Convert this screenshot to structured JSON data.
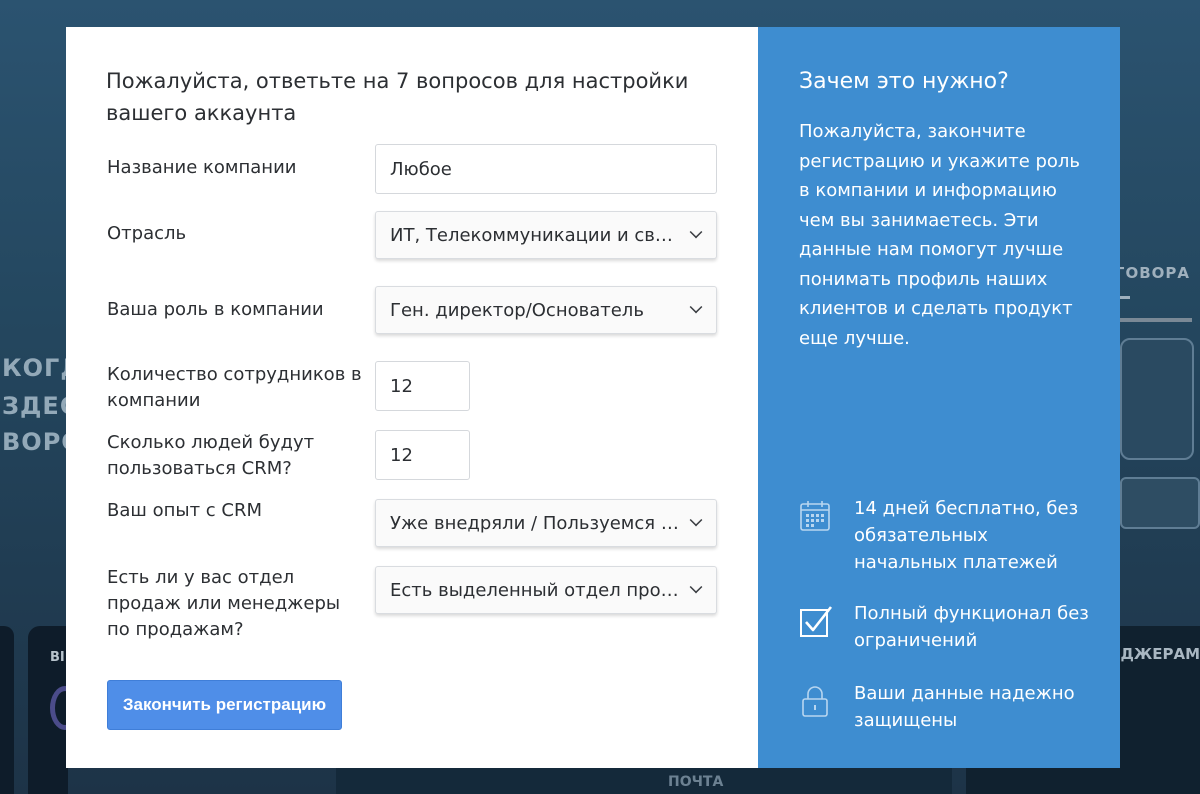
{
  "background": {
    "left_lines": [
      "КОГД",
      "ЗДЕС",
      "ВОРС"
    ],
    "right_heading": "ГОВОРА",
    "right_heading2": "ЕДЖЕРАМ",
    "left_small": "ВІ",
    "bottom_label": "ПОЧТА"
  },
  "form": {
    "title": "Пожалуйста, ответьте на 7 вопросов для настройки вашего аккаунта",
    "company_name": {
      "label": "Название компании",
      "value": "Любое"
    },
    "industry": {
      "label": "Отрасль",
      "value": "ИТ, Телекоммуникации и связь"
    },
    "role": {
      "label": "Ваша роль в компании",
      "value": "Ген. директор/Основатель"
    },
    "employees": {
      "label": "Количество сотрудников в компании",
      "value": "12"
    },
    "crm_users": {
      "label": "Сколько людей будут пользоваться CRM?",
      "value": "12"
    },
    "crm_experience": {
      "label": "Ваш опыт с CRM",
      "value": "Уже внедряли / Пользуемся CRM"
    },
    "sales_dept": {
      "label": "Есть ли у вас отдел продаж или менеджеры по продажам?",
      "value": "Есть выделенный отдел продаж"
    },
    "submit_label": "Закончить регистрацию"
  },
  "info": {
    "title": "Зачем это нужно?",
    "text": "Пожалуйста, закончите регистрацию и укажите роль в компании и информацию чем вы занимаетесь. Эти данные нам помогут лучше понимать профиль наших клиентов и сделать продукт еще лучше.",
    "features": [
      {
        "icon": "calendar-icon",
        "text": "14 дней бесплатно, без обязательных начальных платежей"
      },
      {
        "icon": "checkbox-icon",
        "text": "Полный функционал без ограничений"
      },
      {
        "icon": "lock-icon",
        "text": "Ваши данные надежно защищены"
      }
    ]
  },
  "colors": {
    "accent": "#3e8dd0",
    "button": "#4f8ee8"
  }
}
